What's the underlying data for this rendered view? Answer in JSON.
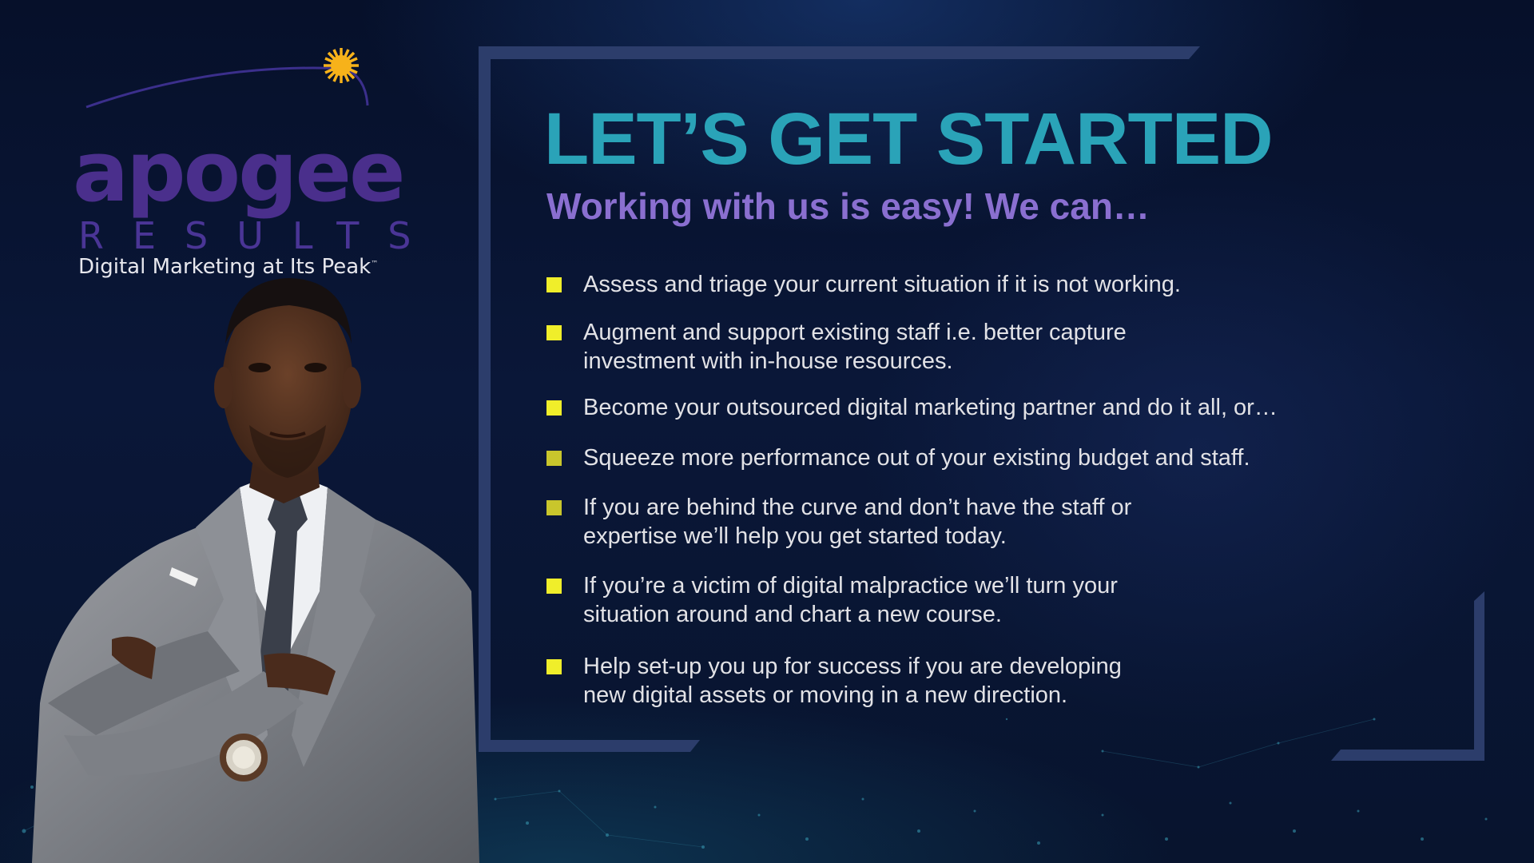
{
  "logo": {
    "word": "apogee",
    "results": "RESULTS",
    "tagline": "Digital Marketing at Its Peak",
    "trademark": "™"
  },
  "heading": {
    "title": "LET’S GET STARTED",
    "subtitle": "Working with us is easy! We can…"
  },
  "bullets": [
    {
      "text": "Assess and triage your current situation if it is not working."
    },
    {
      "text": "Augment and support existing staff i.e. better capture\ninvestment with in-house resources."
    },
    {
      "text": "Become your outsourced digital marketing partner and do it all, or…"
    },
    {
      "text": "Squeeze more performance out of your existing budget and staff."
    },
    {
      "text": "If you are behind the curve and don’t have the staff or\nexpertise we’ll help you get started today."
    },
    {
      "text": "If you’re a victim of digital malpractice we’ll turn your\nsituation around and chart a new course."
    },
    {
      "text": "Help set-up you up for success if you are developing\nnew digital assets or moving in a new direction."
    }
  ],
  "colors": {
    "title": "#2aa3b8",
    "subtitle": "#8a6fd0",
    "bullet": "#f0ee2a",
    "logo": "#4a2f8c",
    "frame": "#2c3d6b"
  },
  "icons": {
    "logo_mark": "sun-icon",
    "bullet_marker": "square-bullet-icon"
  }
}
